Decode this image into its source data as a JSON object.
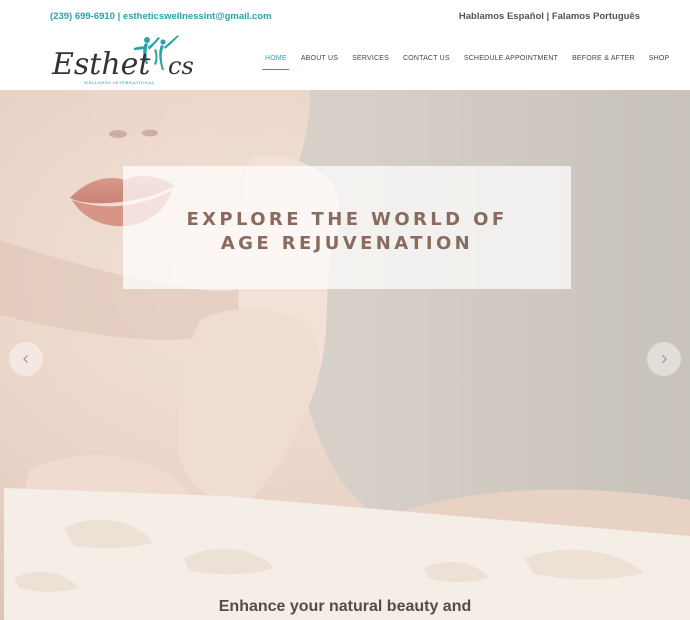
{
  "topbar": {
    "phone": "(239) 699-6910",
    "separator": "|",
    "email": "estheticswellnessint@gmail.com",
    "languages": "Hablamos Español | Falamos Português"
  },
  "logo": {
    "wordmark": "Esthetics",
    "subtitle": "WELLNESS INTERNATIONAL"
  },
  "nav": {
    "items": [
      {
        "label": "HOME"
      },
      {
        "label": "ABOUT US"
      },
      {
        "label": "SERVICES"
      },
      {
        "label": "CONTACT US"
      },
      {
        "label": "SCHEDULE APPOINTMENT"
      },
      {
        "label": "BEFORE & AFTER"
      },
      {
        "label": "SHOP"
      }
    ]
  },
  "hero": {
    "caption_line1": "EXPLORE THE WORLD OF",
    "caption_line2": "AGE REJUVENATION",
    "prev_icon": "chevron-left-icon",
    "next_icon": "chevron-right-icon"
  },
  "intro": {
    "tagline": "Enhance your natural beauty and"
  },
  "colors": {
    "accent": "#2aa3a8",
    "caption": "#8a6b5f",
    "tagline": "#5a4a44"
  }
}
